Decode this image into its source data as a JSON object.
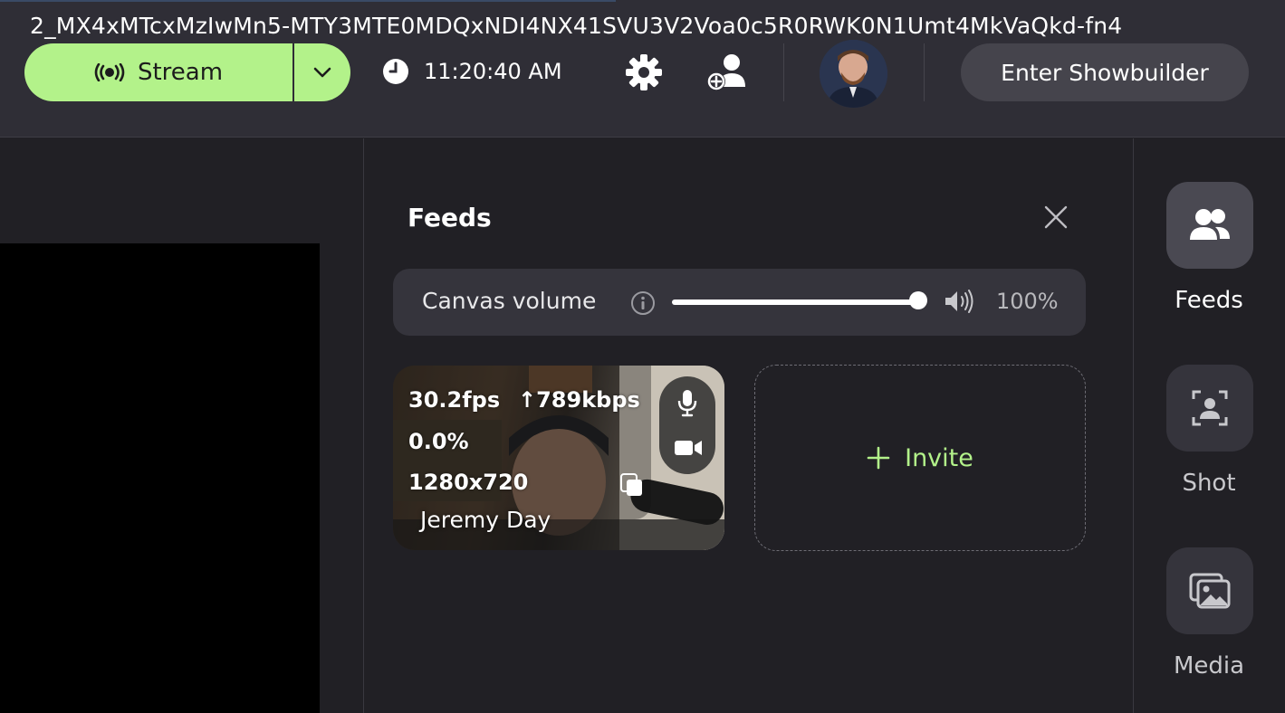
{
  "header": {
    "session_id": "2_MX4xMTcxMzIwMn5-MTY3MTE0MDQxNDI4NX41SVU3V2Voa0c5R0RWK0N1Umt4MkVaQkd-fn4",
    "stream_label": "Stream",
    "time": "11:20:40 AM",
    "showbuilder_label": "Enter Showbuilder"
  },
  "feeds": {
    "title": "Feeds",
    "volume_label": "Canvas volume",
    "volume_value": 1.0,
    "volume_text": "100%",
    "cards": [
      {
        "fps": "30.2fps",
        "bitrate": "↑789kbps",
        "loss": "0.0%",
        "resolution": "1280x720",
        "name": "Jeremy Day"
      }
    ],
    "invite_label": "Invite"
  },
  "rail": {
    "items": [
      {
        "label": "Feeds",
        "icon": "users-icon",
        "active": true
      },
      {
        "label": "Shot",
        "icon": "shot-icon",
        "active": false
      },
      {
        "label": "Media",
        "icon": "media-icon",
        "active": false
      }
    ]
  },
  "colors": {
    "accent": "#b3f28a",
    "topbar": "#2f2e36",
    "panel": "#212025"
  }
}
